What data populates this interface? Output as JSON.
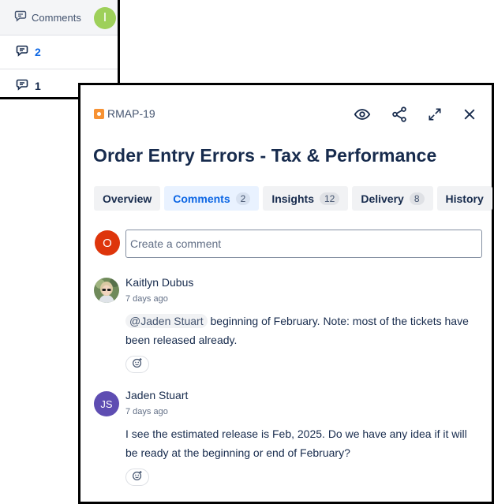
{
  "back_panel": {
    "header_label": "Comments",
    "header_avatar_initial": "I",
    "rows": [
      {
        "count": "2"
      },
      {
        "count": "1"
      }
    ]
  },
  "issue": {
    "key": "RMAP-19",
    "title": "Order Entry Errors - Tax & Performance"
  },
  "tabs": [
    {
      "label": "Overview",
      "count": ""
    },
    {
      "label": "Comments",
      "count": "2"
    },
    {
      "label": "Insights",
      "count": "12"
    },
    {
      "label": "Delivery",
      "count": "8"
    },
    {
      "label": "History",
      "count": ""
    }
  ],
  "composer": {
    "avatar_initial": "O",
    "placeholder": "Create a comment"
  },
  "comments": [
    {
      "author": "Kaitlyn Dubus",
      "ago": "7 days ago",
      "mention": "@Jaden Stuart",
      "text": " beginning of February.  Note:  most of the tickets have been released already."
    },
    {
      "author": "Jaden Stuart",
      "avatar_initials": "JS",
      "ago": "7 days ago",
      "text": "I see the estimated release is Feb, 2025. Do we have any idea if it will be ready at the beginning or end of February?"
    }
  ],
  "colors": {
    "accent": "#0c66e4",
    "me_avatar": "#de350b",
    "js_avatar": "#5e4db2",
    "back_avatar": "#9ed05a"
  }
}
